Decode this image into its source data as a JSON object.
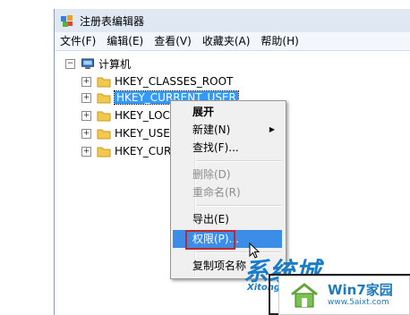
{
  "window": {
    "title": "注册表编辑器"
  },
  "menubar": [
    "文件(F)",
    "编辑(E)",
    "查看(V)",
    "收藏夹(A)",
    "帮助(H)"
  ],
  "tree": {
    "root": "计算机",
    "keys": [
      "HKEY_CLASSES_ROOT",
      "HKEY_CURRENT_USER",
      "HKEY_LOCA",
      "HKEY_USER",
      "HKEY_CURI"
    ]
  },
  "context_menu": {
    "expand": "展开",
    "new": "新建(N)",
    "find": "查找(F)...",
    "delete": "删除(D)",
    "rename": "重命名(R)",
    "export": "导出(E)",
    "permissions": "权限(P)...",
    "copy_key_name": "复制项名称"
  },
  "watermark": {
    "logo": "系统城",
    "sub": "Xitong",
    "badge": "Win7家园",
    "url": "www.5aixt.com"
  },
  "colors": {
    "selection": "#3399ff",
    "highlight_box": "#c0282d",
    "menu_hover": "#3b8de8"
  }
}
